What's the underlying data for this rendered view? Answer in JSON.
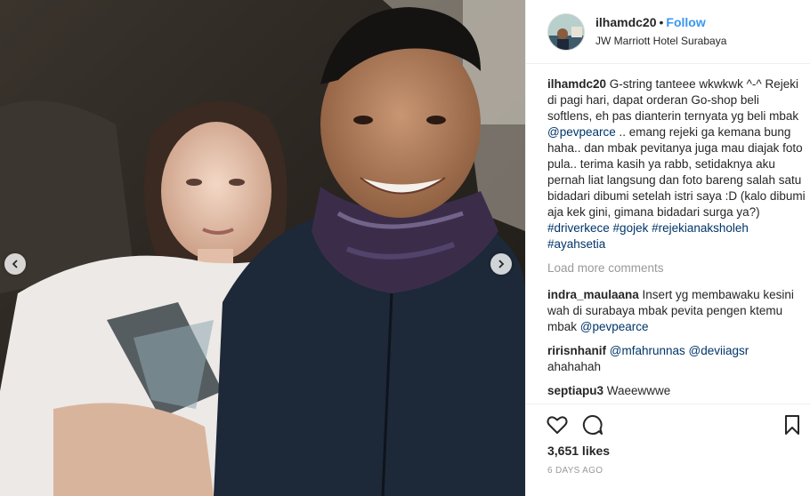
{
  "post": {
    "username": "ilhamdc20",
    "separator": "•",
    "follow_label": "Follow",
    "location": "JW Marriott Hotel Surabaya"
  },
  "caption": {
    "username": "ilhamdc20",
    "text_1": " G-string tanteee wkwkwk ^-^ Rejeki di pagi hari, dapat orderan Go-shop beli softlens, eh pas dianterin ternyata yg beli mbak ",
    "mention": "@pevpearce",
    "text_2": " .. emang rejeki ga kemana bung haha.. dan mbak pevitanya juga mau diajak foto pula.. terima kasih ya rabb, setidaknya aku pernah liat langsung dan foto bareng salah satu bidadari dibumi setelah istri saya :D (kalo dibumi aja kek gini, gimana bidadari surga ya?) ",
    "hashtags": [
      "#driverkece",
      "#gojek",
      "#rejekianaksholeh",
      "#ayahsetia"
    ]
  },
  "load_more_label": "Load more comments",
  "comments": [
    {
      "username": "indra_maulaana",
      "text": " Insert yg membawaku kesini wah di surabaya mbak pevita pengen ktemu mbak ",
      "mention": "@pevpearce"
    },
    {
      "username": "ririsnhanif",
      "mention_1": "@mfahrunnas",
      "mention_2": "@deviiagsr",
      "text": "ahahahah"
    },
    {
      "username": "septiapu3",
      "text": " Waeewwwe"
    }
  ],
  "likes_text": "3,651 likes",
  "time_text": "6 DAYS AGO",
  "icons": {
    "like": "heart-icon",
    "comment": "comment-icon",
    "save": "bookmark-icon",
    "prev": "chevron-left-icon",
    "next": "chevron-right-icon"
  },
  "colors": {
    "link": "#003569",
    "follow": "#3897f0",
    "muted": "#999999",
    "border": "#efefef"
  }
}
